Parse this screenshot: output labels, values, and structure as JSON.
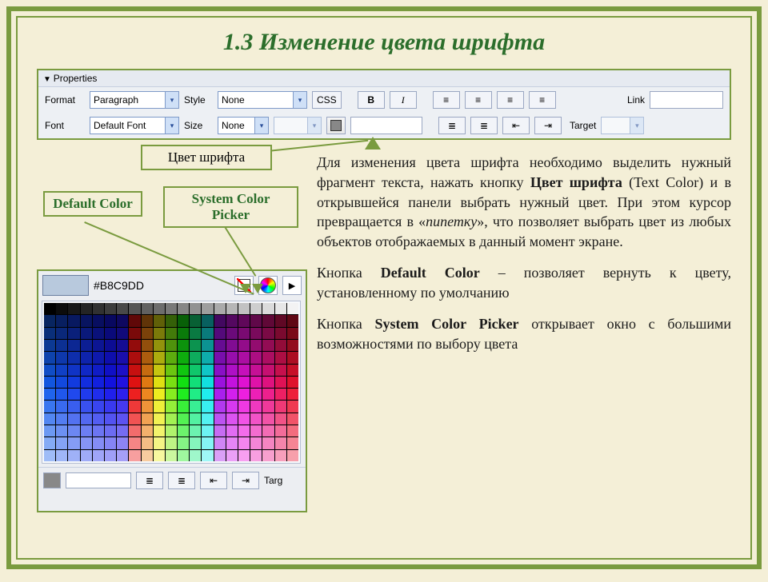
{
  "title": "1.3  Изменение цвета шрифта",
  "props": {
    "header": "Properties",
    "row1": {
      "format_label": "Format",
      "format_value": "Paragraph",
      "style_label": "Style",
      "style_value": "None",
      "css_btn": "CSS",
      "bold": "B",
      "italic": "I",
      "link_label": "Link"
    },
    "row2": {
      "font_label": "Font",
      "font_value": "Default Font",
      "size_label": "Size",
      "size_value": "None",
      "target_label": "Target"
    }
  },
  "callouts": {
    "font_color": "Цвет шрифта",
    "default_color": "Default Color",
    "system_picker": "System Color Picker"
  },
  "picker": {
    "hex": "#B8C9DD",
    "bottom_target": "Targ"
  },
  "text": {
    "p1a": "Для изменения цвета шрифта необходимо выделить нужный фрагмент текста, нажать кнопку ",
    "p1b": "Цвет шрифта",
    "p1c": " (Text Color) и в открывшейся панели выбрать нужный цвет. При этом курсор превращается в «",
    "p1d": "пипетку",
    "p1e": "», что позволяет выбрать цвет из любых объектов отображаемых в данный момент экране.",
    "p2a": "Кнопка ",
    "p2b": "Default Color",
    "p2c": " – позволяет вернуть к цвету, установленному по умолчанию",
    "p3a": "Кнопка ",
    "p3b": "System Color Picker",
    "p3c": " открывает окно с большими возможностями по выбору цвета"
  }
}
